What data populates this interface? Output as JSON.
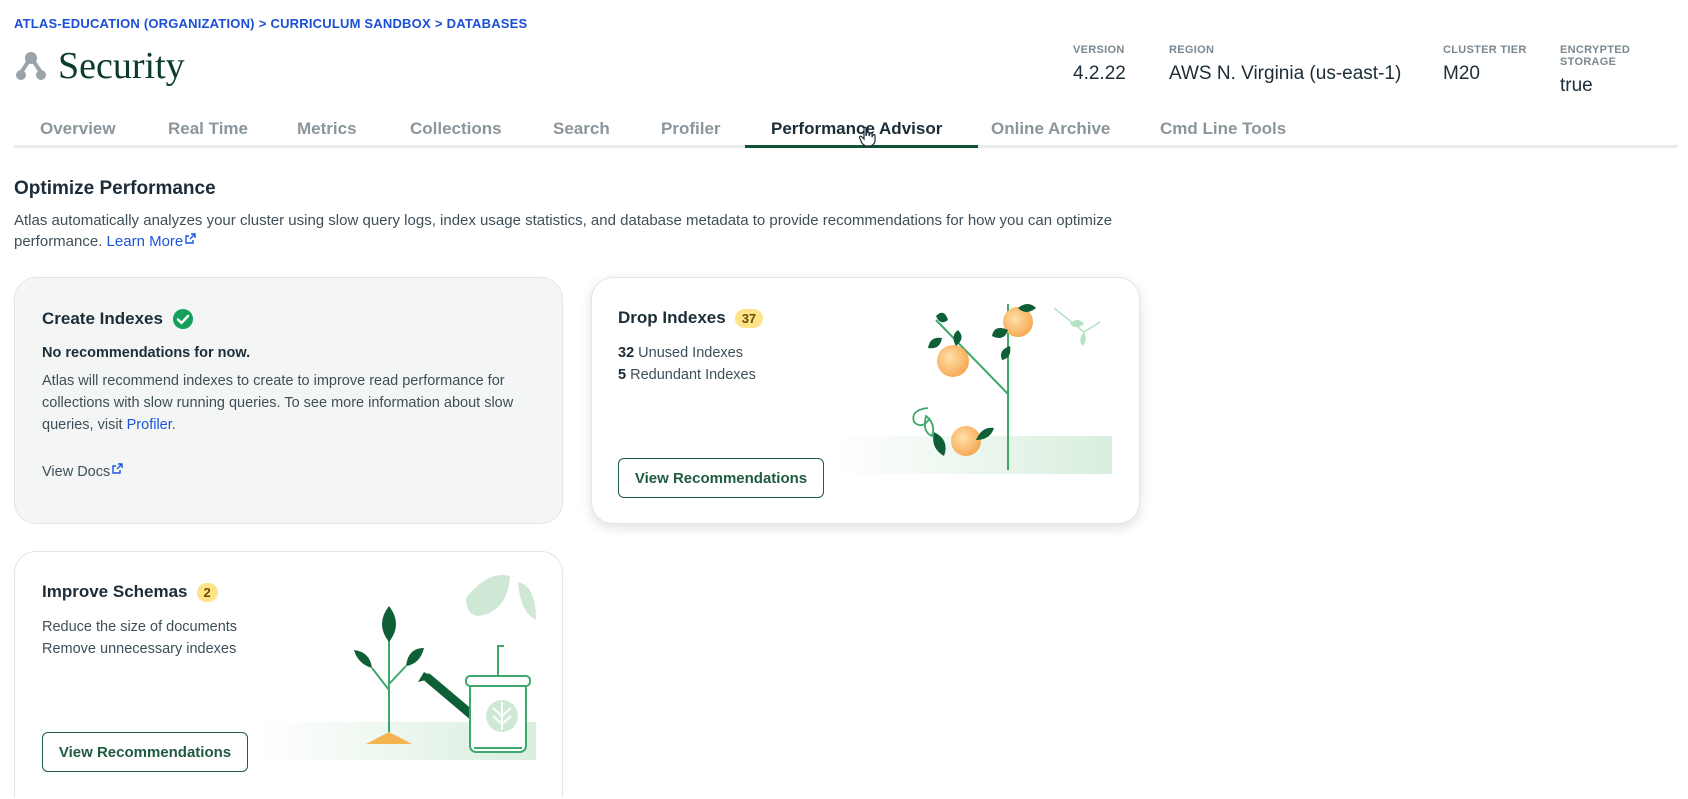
{
  "breadcrumb": {
    "org": "ATLAS-EDUCATION (ORGANIZATION)",
    "project": "CURRICULUM SANDBOX",
    "section": "DATABASES",
    "separator": ">"
  },
  "page": {
    "title": "Security",
    "icon": "atlas-cluster-icon"
  },
  "cluster_meta": [
    {
      "label": "VERSION",
      "value": "4.2.22"
    },
    {
      "label": "REGION",
      "value": "AWS N. Virginia (us-east-1)"
    },
    {
      "label": "CLUSTER TIER",
      "value": "M20"
    },
    {
      "label": "ENCRYPTED STORAGE",
      "value": "true"
    }
  ],
  "tabs": [
    {
      "label": "Overview"
    },
    {
      "label": "Real Time"
    },
    {
      "label": "Metrics"
    },
    {
      "label": "Collections"
    },
    {
      "label": "Search"
    },
    {
      "label": "Profiler"
    },
    {
      "label": "Performance Advisor",
      "active": true
    },
    {
      "label": "Online Archive"
    },
    {
      "label": "Cmd Line Tools"
    }
  ],
  "optimize": {
    "title": "Optimize Performance",
    "description": "Atlas automatically analyzes your cluster using slow query logs, index usage statistics, and database metadata to provide recommendations for how you can optimize performance.",
    "learn_more": "Learn More"
  },
  "create_indexes": {
    "title": "Create Indexes",
    "status": "No recommendations for now.",
    "text_before": "Atlas will recommend indexes to create to improve read performance for collections with slow running queries. To see more information about slow queries, visit ",
    "profiler_link": "Profiler",
    "text_after": ".",
    "view_docs": "View Docs"
  },
  "drop_indexes": {
    "title": "Drop Indexes",
    "badge": "37",
    "unused_count": "32",
    "unused_label": "Unused Indexes",
    "redundant_count": "5",
    "redundant_label": "Redundant Indexes",
    "button": "View Recommendations"
  },
  "improve_schemas": {
    "title": "Improve Schemas",
    "badge": "2",
    "line1": "Reduce the size of documents",
    "line2": "Remove unnecessary indexes",
    "button": "View Recommendations"
  },
  "colors": {
    "brand_green": "#0f5132",
    "link_blue": "#1a56db",
    "badge_yellow": "#ffe38a",
    "check_green": "#13a05a"
  }
}
